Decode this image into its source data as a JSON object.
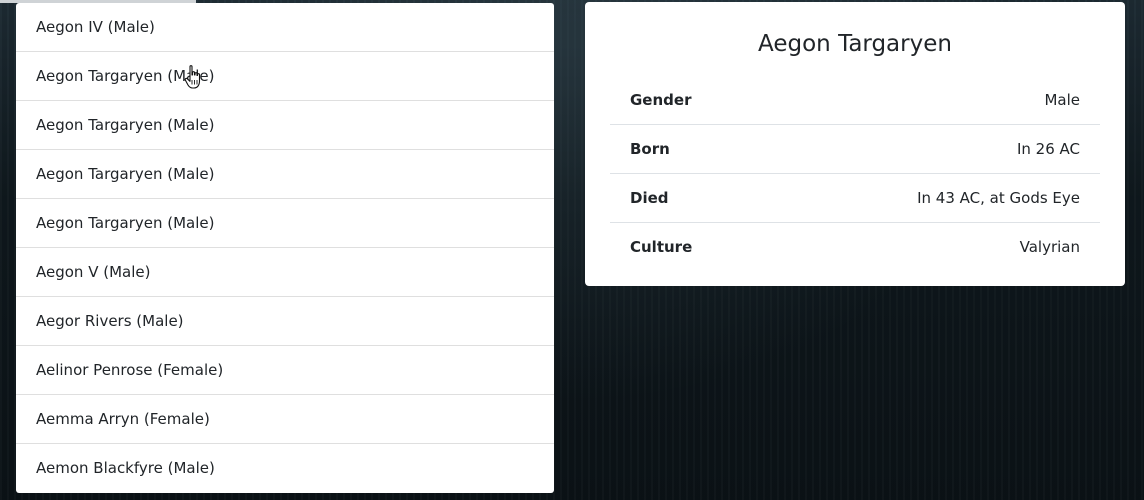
{
  "characters": [
    {
      "label": "Aegon IV (Male)"
    },
    {
      "label": "Aegon Targaryen (Male)"
    },
    {
      "label": "Aegon Targaryen (Male)"
    },
    {
      "label": "Aegon Targaryen (Male)"
    },
    {
      "label": "Aegon Targaryen (Male)"
    },
    {
      "label": "Aegon V (Male)"
    },
    {
      "label": "Aegor Rivers (Male)"
    },
    {
      "label": "Aelinor Penrose (Female)"
    },
    {
      "label": "Aemma Arryn (Female)"
    },
    {
      "label": "Aemon Blackfyre (Male)"
    }
  ],
  "detail": {
    "title": "Aegon Targaryen",
    "rows": [
      {
        "key": "Gender",
        "value": "Male"
      },
      {
        "key": "Born",
        "value": "In 26 AC"
      },
      {
        "key": "Died",
        "value": "In 43 AC, at Gods Eye"
      },
      {
        "key": "Culture",
        "value": "Valyrian"
      }
    ]
  },
  "cursor_icon": "hand-pointer-icon"
}
